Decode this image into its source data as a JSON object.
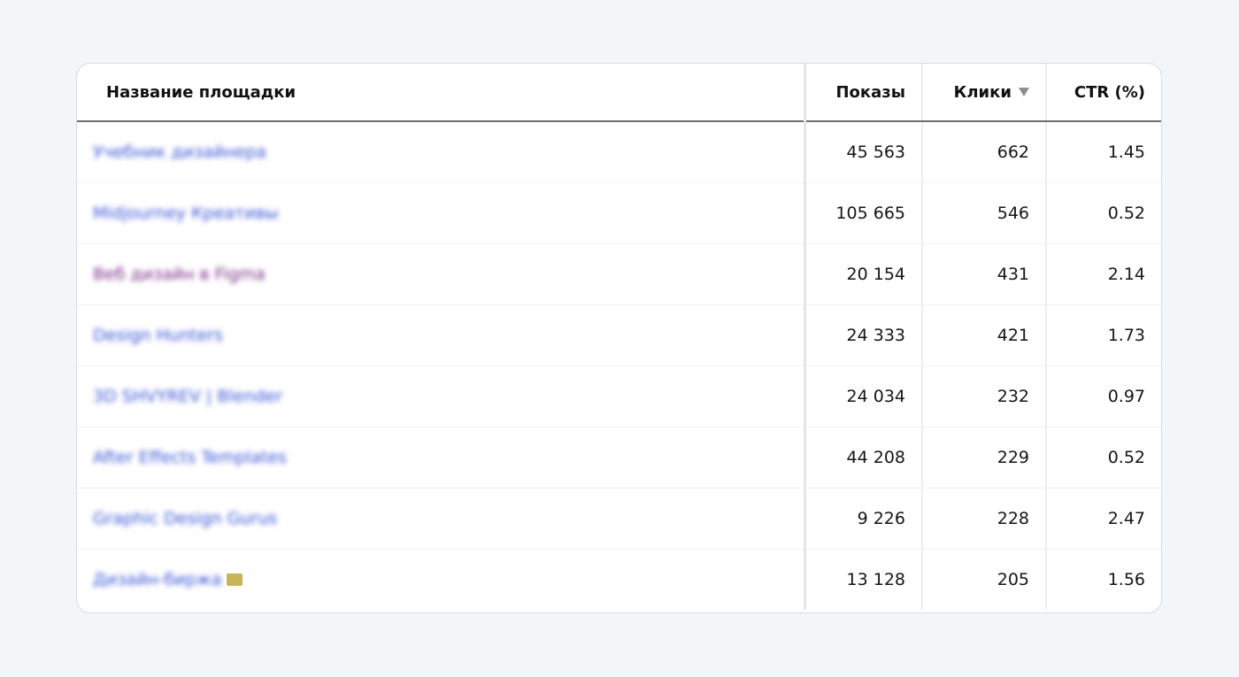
{
  "table": {
    "headers": {
      "name": "Название площадки",
      "impressions": "Показы",
      "clicks": "Клики",
      "ctr": "CTR (%)"
    },
    "sort": {
      "column": "clicks",
      "direction": "desc",
      "icon": "sort-down-icon"
    },
    "rows": [
      {
        "name": "Учебник дизайнера",
        "impressions": "45 563",
        "clicks": "662",
        "ctr": "1.45"
      },
      {
        "name": "Midjourney Креативы",
        "impressions": "105 665",
        "clicks": "546",
        "ctr": "0.52"
      },
      {
        "name": "Веб дизайн в Figma",
        "impressions": "20 154",
        "clicks": "431",
        "ctr": "2.14"
      },
      {
        "name": "Design Hunters",
        "impressions": "24 333",
        "clicks": "421",
        "ctr": "1.73"
      },
      {
        "name": "3D SHVYREV | Blender",
        "impressions": "24 034",
        "clicks": "232",
        "ctr": "0.97"
      },
      {
        "name": "After Effects Templates",
        "impressions": "44 208",
        "clicks": "229",
        "ctr": "0.52"
      },
      {
        "name": "Graphic Design Gurus",
        "impressions": "9 226",
        "clicks": "228",
        "ctr": "2.47"
      },
      {
        "name": "Дизайн-биржа",
        "impressions": "13 128",
        "clicks": "205",
        "ctr": "1.56"
      }
    ]
  },
  "colors": {
    "page_background": "#f2f6f9",
    "link": "#3a55d6",
    "visited_link": "#7a2b88",
    "text": "#151515"
  }
}
